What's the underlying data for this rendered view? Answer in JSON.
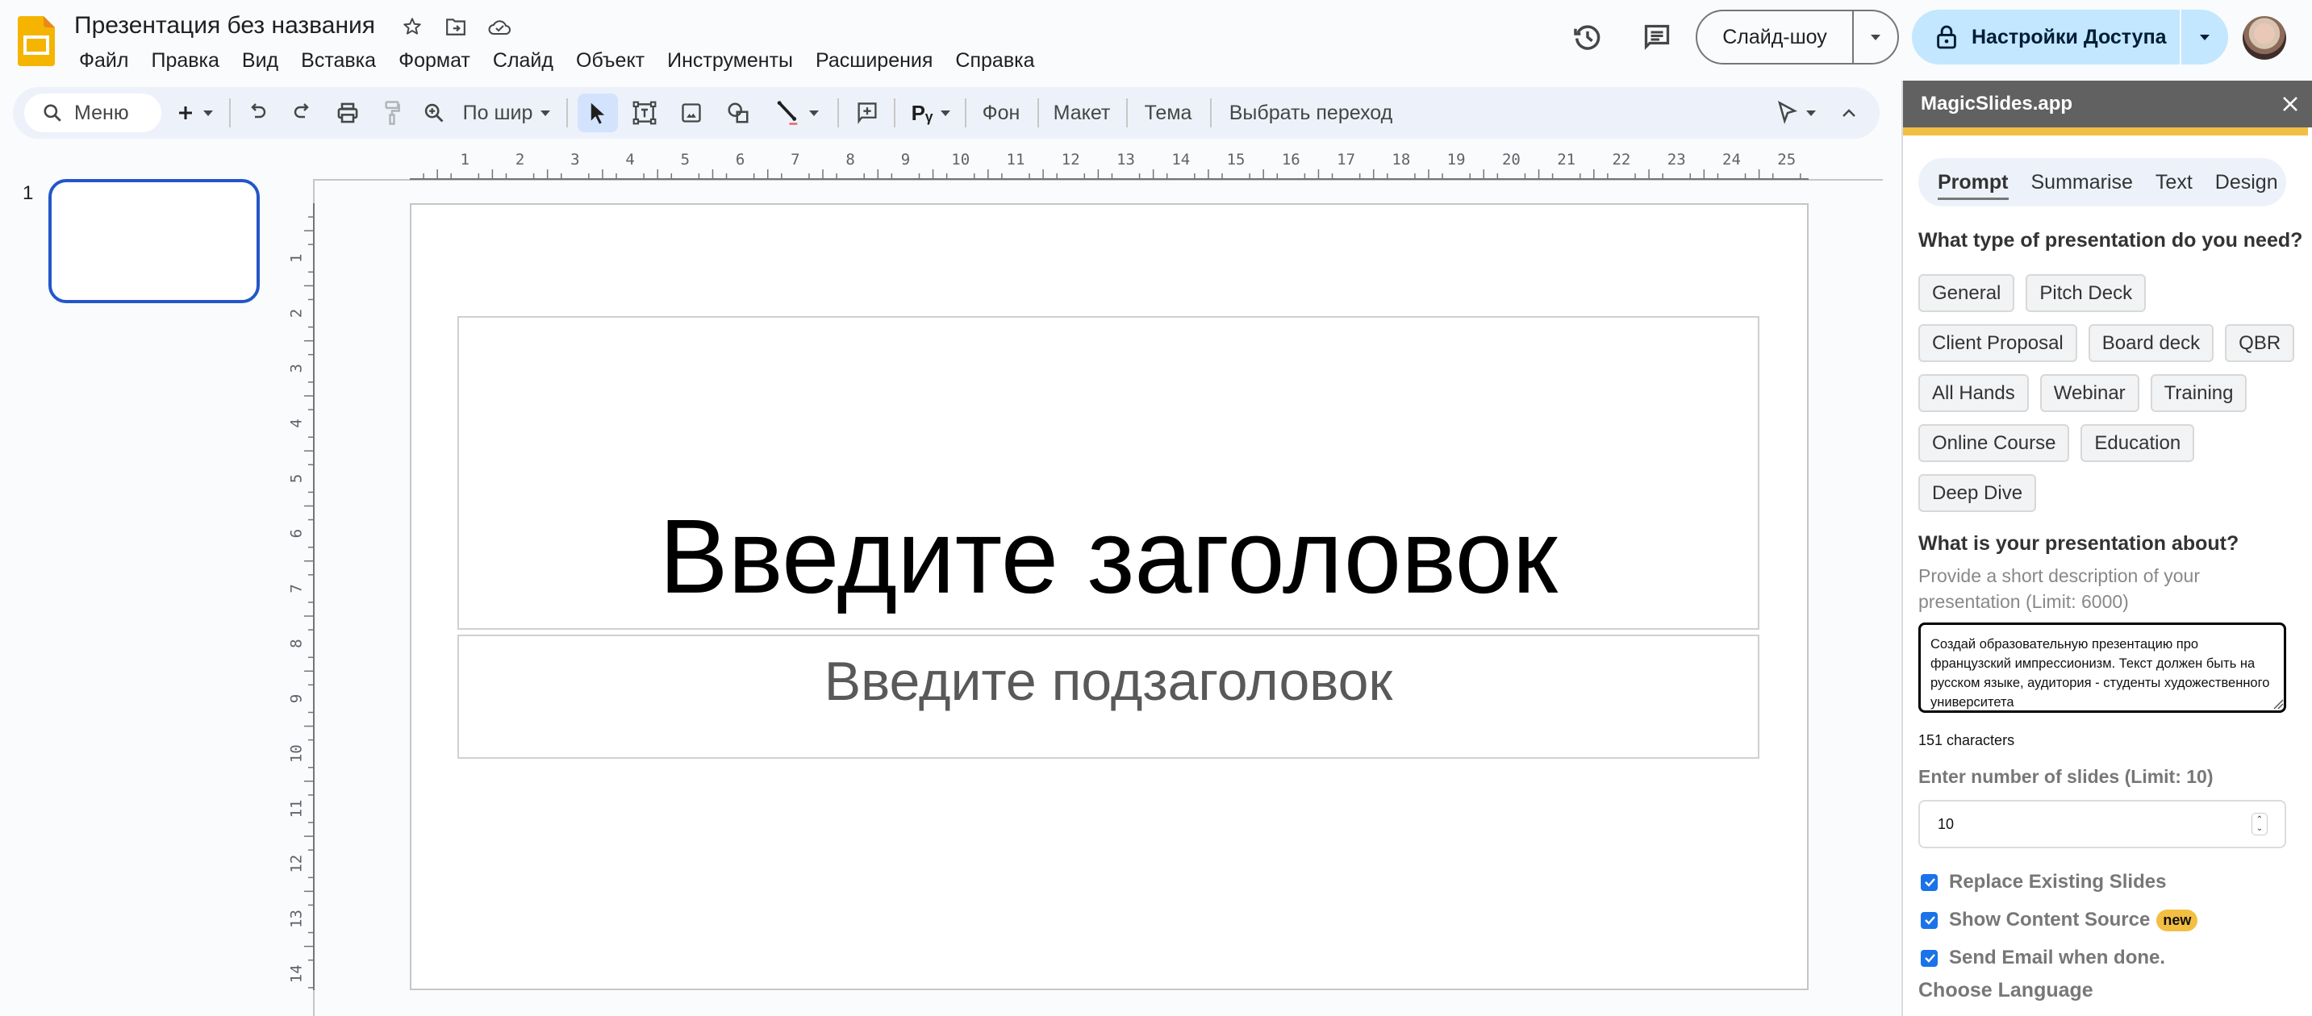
{
  "app": {
    "title": "Презентация без названия",
    "icons": [
      "star-icon",
      "move-to-folder-icon",
      "cloud-saved-icon"
    ]
  },
  "menu": [
    "Файл",
    "Правка",
    "Вид",
    "Вставка",
    "Формат",
    "Слайд",
    "Объект",
    "Инструменты",
    "Расширения",
    "Справка"
  ],
  "header_actions": {
    "slideshow_label": "Слайд-шоу",
    "share_label": "Настройки Доступа",
    "icons": [
      "history-icon",
      "comments-icon",
      "lock-icon",
      "avatar"
    ]
  },
  "toolbar": {
    "search_placeholder": "Меню",
    "zoom_label": "По шир",
    "background_label": "Фон",
    "layout_label": "Макет",
    "theme_label": "Тема",
    "transition_label": "Выбрать переход"
  },
  "filmstrip": {
    "slides": [
      {
        "number": "1"
      }
    ]
  },
  "rulers": {
    "horizontal": [
      "1",
      "2",
      "3",
      "4",
      "5",
      "6",
      "7",
      "8",
      "9",
      "10",
      "11",
      "12",
      "13",
      "14",
      "15",
      "16",
      "17",
      "18",
      "19",
      "20",
      "21",
      "22",
      "23",
      "24",
      "25"
    ],
    "vertical": [
      "1",
      "2",
      "3",
      "4",
      "5",
      "6",
      "7",
      "8",
      "9",
      "10",
      "11",
      "12",
      "13",
      "14"
    ]
  },
  "slide": {
    "title_placeholder": "Введите заголовок",
    "subtitle_placeholder": "Введите подзаголовок"
  },
  "panel": {
    "title": "MagicSlides.app",
    "tabs": [
      {
        "label": "Prompt",
        "active": true
      },
      {
        "label": "Summarise",
        "active": false
      },
      {
        "label": "Text",
        "active": false
      },
      {
        "label": "Design",
        "active": false
      }
    ],
    "type_question": "What type of presentation do you need?",
    "types": [
      "General",
      "Pitch Deck",
      "Client Proposal",
      "Board deck",
      "QBR",
      "All Hands",
      "Webinar",
      "Training",
      "Online Course",
      "Education",
      "Deep Dive"
    ],
    "about_question": "What is your presentation about?",
    "about_hint": "Provide a short description of your presentation (Limit: 6000)",
    "about_value": "Создай образовательную презентацию про французский импрессионизм. Текст должен быть на русском языке, аудитория - студенты художественного университета",
    "char_count": "151 characters",
    "slides_label": "Enter number of slides (Limit: 10)",
    "slides_value": "10",
    "options": [
      {
        "label": "Replace Existing Slides",
        "checked": true
      },
      {
        "label": "Show Content Source",
        "checked": true,
        "badge": "new"
      },
      {
        "label": "Send Email when done.",
        "checked": true
      }
    ],
    "language_label": "Choose Language",
    "accent_color": "#f2bf42",
    "header_color": "#616161"
  }
}
